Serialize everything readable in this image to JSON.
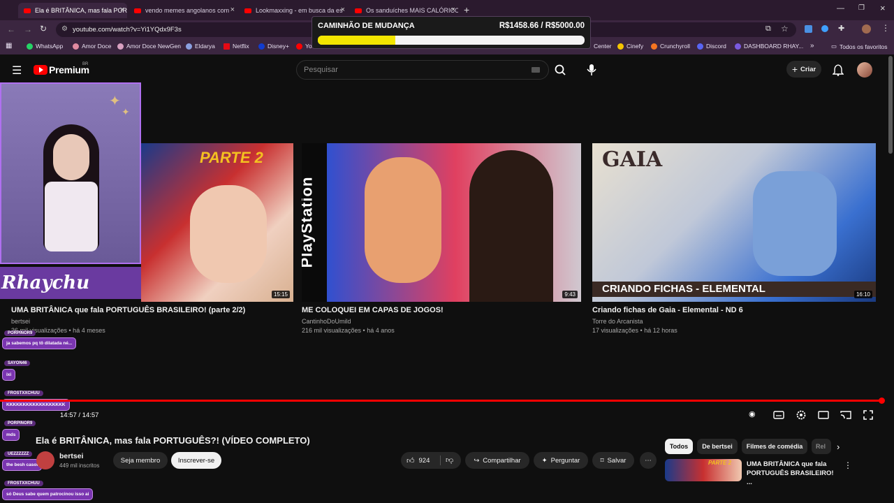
{
  "browser": {
    "tabs": [
      {
        "label": "Ela é BRITÂNICA, mas fala PORTU",
        "active": true
      },
      {
        "label": "vendo memes angolanos com",
        "active": false
      },
      {
        "label": "Lookmaxxing - em busca da es",
        "active": false
      },
      {
        "label": "Os sanduíches MAIS CALÓRICO",
        "active": false
      }
    ],
    "url": "youtube.com/watch?v=Yi1YQdx9F3s",
    "bookmarks": [
      "WhatsApp",
      "Amor Doce",
      "Amor Doce NewGen",
      "Eldarya",
      "Netflix",
      "Disney+",
      "Yo",
      "Center",
      "Cinefy",
      "Crunchyroll",
      "Discord",
      "DASHBOARD RHAY..."
    ],
    "favorites_label": "Todos os favoritos"
  },
  "goal": {
    "title": "CAMINHÃO DE MUDANÇA",
    "amount": "R$1458.66 / R$5000.00",
    "progress": 0.2917
  },
  "youtube": {
    "logo": "Premium",
    "region": "BR",
    "search_placeholder": "Pesquisar",
    "create_label": "Criar"
  },
  "streamer": {
    "name": "Rhaychu"
  },
  "cards": [
    {
      "title": "UMA BRITÂNICA que fala PORTUGUÊS BRASILEIRO! (parte 2/2)",
      "channel": "bertsei",
      "meta": "36 mil visualizações • há 4 meses",
      "duration": "15:15",
      "thumb_text": "PARTE 2"
    },
    {
      "title": "ME COLOQUEI EM CAPAS DE JOGOS!",
      "channel": "CantinhoDoUmild",
      "meta": "216 mil visualizações • há 4 anos",
      "duration": "9:43",
      "thumb_text": "PlayStation"
    },
    {
      "title": "Criando fichas de Gaia - Elemental - ND 6",
      "channel": "Torre do Arcanista",
      "meta": "17 visualizações • há 12 horas",
      "duration": "16:10",
      "thumb_text": "GAIA",
      "thumb_banner": "CRIANDO FICHAS - ELEMENTAL"
    }
  ],
  "chat": [
    {
      "user": "PORPINOR9",
      "msg": "ja sabemos pq tô dilatada né..."
    },
    {
      "user": "SAYON46",
      "msg": "ixi"
    },
    {
      "user": "FROSTXXCHUU",
      "msg": "KKKKKKKKKKKKKKKKKK"
    },
    {
      "user": "PORPINOR9",
      "msg": "mds"
    },
    {
      "user": "UEZZZZZZ",
      "msg": "the besh casol"
    },
    {
      "user": "FROSTXXCHUU",
      "msg": "só Deus sabe quem patrocinou isso ai"
    }
  ],
  "player": {
    "time": "14:57 / 14:57",
    "progress": 1.0
  },
  "video": {
    "title": "Ela é BRITÂNICA, mas fala PORTUGUÊS?! (VÍDEO COMPLETO)",
    "channel": "bertsei",
    "subscribers": "449 mil inscritos",
    "join_label": "Seja membro",
    "subscribe_label": "Inscrever-se",
    "likes": "924",
    "share_label": "Compartilhar",
    "ask_label": "Perguntar",
    "save_label": "Salvar"
  },
  "chips": [
    "Todos",
    "De bertsei",
    "Filmes de comédia",
    "Rel"
  ],
  "up_next": {
    "title": "UMA BRITÂNICA que fala PORTUGUÊS BRASILEIRO! ...",
    "thumb_text": "PARTE 2"
  }
}
